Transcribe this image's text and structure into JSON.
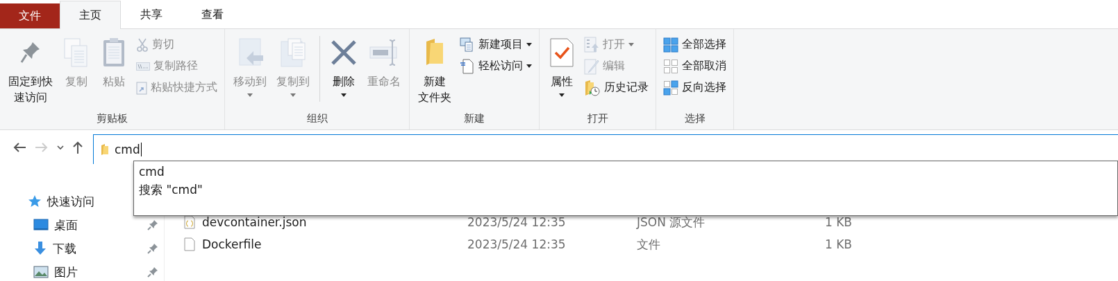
{
  "tabs": [
    {
      "label": "文件",
      "kind": "file",
      "selected": false
    },
    {
      "label": "主页",
      "kind": "tab",
      "selected": true
    },
    {
      "label": "共享",
      "kind": "tab",
      "selected": false
    },
    {
      "label": "查看",
      "kind": "tab",
      "selected": false
    }
  ],
  "ribbon": {
    "groups": [
      {
        "label": "剪贴板",
        "items": [
          {
            "kind": "large",
            "lines": [
              "固定到快",
              "速访问"
            ],
            "disabled": false,
            "has_menu": false
          },
          {
            "kind": "large",
            "lines": [
              "复制"
            ],
            "disabled": true,
            "has_menu": false
          },
          {
            "kind": "large",
            "lines": [
              "粘贴"
            ],
            "disabled": true,
            "has_menu": false
          },
          {
            "kind": "stack",
            "items": [
              {
                "label": "剪切",
                "disabled": true,
                "has_menu": false
              },
              {
                "label": "复制路径",
                "disabled": true,
                "has_menu": false
              },
              {
                "label": "粘贴快捷方式",
                "disabled": true,
                "has_menu": false
              }
            ]
          }
        ]
      },
      {
        "label": "组织",
        "items": [
          {
            "kind": "large",
            "lines": [
              "移动到"
            ],
            "disabled": true,
            "has_menu": true
          },
          {
            "kind": "large",
            "lines": [
              "复制到"
            ],
            "disabled": true,
            "has_menu": true
          },
          {
            "kind": "separator"
          },
          {
            "kind": "large",
            "lines": [
              "删除"
            ],
            "disabled": false,
            "has_menu": true
          },
          {
            "kind": "large",
            "lines": [
              "重命名"
            ],
            "disabled": true,
            "has_menu": false
          }
        ]
      },
      {
        "label": "新建",
        "items": [
          {
            "kind": "large",
            "lines": [
              "新建",
              "文件夹"
            ],
            "disabled": false,
            "has_menu": false
          },
          {
            "kind": "stack",
            "items": [
              {
                "label": "新建项目",
                "disabled": false,
                "has_menu": true
              },
              {
                "label": "轻松访问",
                "disabled": false,
                "has_menu": true
              }
            ]
          }
        ]
      },
      {
        "label": "打开",
        "items": [
          {
            "kind": "large",
            "lines": [
              "属性"
            ],
            "disabled": false,
            "has_menu": true
          },
          {
            "kind": "stack",
            "items": [
              {
                "label": "打开",
                "disabled": true,
                "has_menu": true
              },
              {
                "label": "编辑",
                "disabled": true,
                "has_menu": false
              },
              {
                "label": "历史记录",
                "disabled": false,
                "has_menu": false
              }
            ]
          }
        ]
      },
      {
        "label": "选择",
        "items": [
          {
            "kind": "stack",
            "items": [
              {
                "label": "全部选择",
                "disabled": false,
                "has_menu": false
              },
              {
                "label": "全部取消",
                "disabled": false,
                "has_menu": false
              },
              {
                "label": "反向选择",
                "disabled": false,
                "has_menu": false
              }
            ]
          }
        ]
      }
    ]
  },
  "nav": {
    "back_disabled": false,
    "forward_disabled": true
  },
  "address": {
    "value": "cmd",
    "suggestions": [
      "cmd",
      "搜索 \"cmd\""
    ]
  },
  "sidebar": {
    "items": [
      {
        "label": "快速访问"
      },
      {
        "label": "桌面",
        "pinned": true
      },
      {
        "label": "下载",
        "pinned": true
      },
      {
        "label": "图片",
        "pinned": true
      }
    ]
  },
  "files": [
    {
      "name": "devcontainer.json",
      "date": "2023/5/24 12:35",
      "type": "JSON 源文件",
      "size": "1 KB"
    },
    {
      "name": "Dockerfile",
      "date": "2023/5/24 12:35",
      "type": "文件",
      "size": "1 KB"
    }
  ]
}
